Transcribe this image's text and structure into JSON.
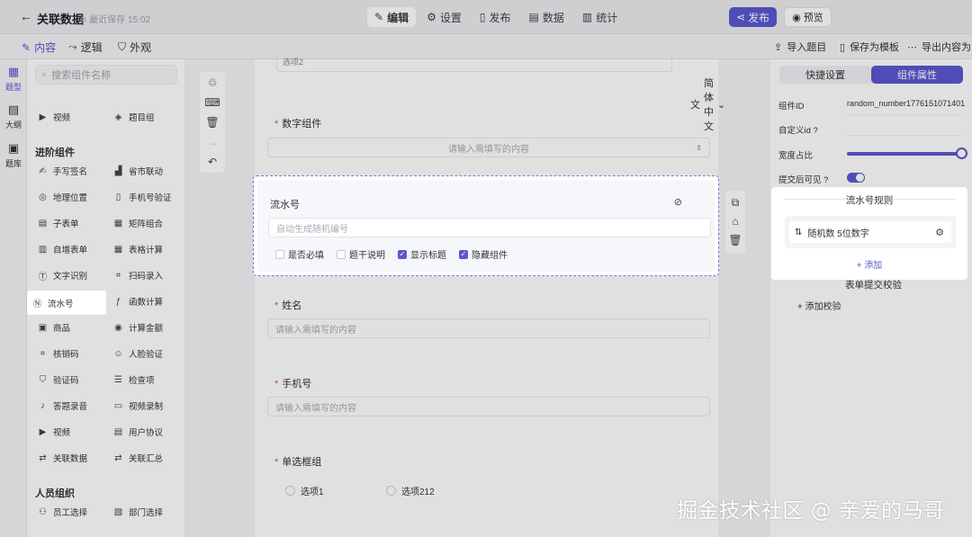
{
  "header": {
    "back_icon": "arrow-left-icon",
    "title": "关联数据",
    "save_status": "最近保存 15:02",
    "tabs": [
      {
        "label": "编辑",
        "icon": "edit-icon",
        "active": true
      },
      {
        "label": "设置",
        "icon": "gear-icon"
      },
      {
        "label": "发布",
        "icon": "file-icon"
      },
      {
        "label": "数据",
        "icon": "database-icon"
      },
      {
        "label": "统计",
        "icon": "chart-icon"
      }
    ],
    "publish_label": "发布",
    "preview_label": "预览"
  },
  "subbar": {
    "tabs": [
      {
        "label": "内容",
        "icon": "edit-icon",
        "active": true
      },
      {
        "label": "逻辑",
        "icon": "logic-icon"
      },
      {
        "label": "外观",
        "icon": "shirt-icon"
      }
    ],
    "actions": [
      {
        "label": "导入题目",
        "icon": "upload-icon"
      },
      {
        "label": "保存为模板",
        "icon": "template-icon"
      },
      {
        "label": "导出内容为",
        "icon": "more-icon"
      }
    ]
  },
  "rail": [
    {
      "label": "题型",
      "icon": "grid-icon",
      "active": true
    },
    {
      "label": "大纲",
      "icon": "outline-icon"
    },
    {
      "label": "题库",
      "icon": "library-icon"
    }
  ],
  "component_panel": {
    "search_placeholder": "搜索组件名称",
    "top_items": [
      {
        "label": "视频",
        "icon": "play-icon"
      },
      {
        "label": "题目组",
        "icon": "layers-icon"
      }
    ],
    "advanced_title": "进阶组件",
    "advanced": [
      {
        "label": "手写签名",
        "icon": "pen-icon"
      },
      {
        "label": "省市联动",
        "icon": "city-icon"
      },
      {
        "label": "地理位置",
        "icon": "location-icon"
      },
      {
        "label": "手机号验证",
        "icon": "phone-icon"
      },
      {
        "label": "子表单",
        "icon": "subform-icon"
      },
      {
        "label": "矩阵组合",
        "icon": "matrix-icon"
      },
      {
        "label": "自增表单",
        "icon": "table-add-icon"
      },
      {
        "label": "表格计算",
        "icon": "table-calc-icon"
      },
      {
        "label": "文字识别",
        "icon": "ocr-icon"
      },
      {
        "label": "扫码录入",
        "icon": "scan-icon"
      },
      {
        "label": "流水号",
        "icon": "serial-number-icon",
        "highlight": true
      },
      {
        "label": "函数计算",
        "icon": "function-icon"
      },
      {
        "label": "商品",
        "icon": "goods-icon"
      },
      {
        "label": "计算金额",
        "icon": "money-icon"
      },
      {
        "label": "核销码",
        "icon": "qr-icon"
      },
      {
        "label": "人脸验证",
        "icon": "face-icon"
      },
      {
        "label": "验证码",
        "icon": "shield-icon"
      },
      {
        "label": "检查项",
        "icon": "checklist-icon"
      },
      {
        "label": "答题录音",
        "icon": "mic-icon"
      },
      {
        "label": "视频录制",
        "icon": "video-record-icon"
      },
      {
        "label": "视频",
        "icon": "play-icon"
      },
      {
        "label": "用户协议",
        "icon": "agreement-icon"
      },
      {
        "label": "关联数据",
        "icon": "link-data-icon"
      },
      {
        "label": "关联汇总",
        "icon": "link-summary-icon"
      }
    ],
    "people_title": "人员组织",
    "people": [
      {
        "label": "员工选择",
        "icon": "user-icon"
      },
      {
        "label": "部门选择",
        "icon": "dept-icon"
      }
    ]
  },
  "canvas": {
    "top_stub_text": "选项2",
    "lang_label": "简体中文",
    "fields": [
      {
        "label": "数字组件",
        "required": true,
        "placeholder": "请输入需填写的内容"
      },
      {
        "label": "姓名",
        "required": true,
        "placeholder": "请输入需填写的内容"
      },
      {
        "label": "手机号",
        "required": true,
        "placeholder": "请输入需填写的内容"
      },
      {
        "label": "单选框组",
        "required": true
      }
    ],
    "radio_options": [
      "选项1",
      "选项212"
    ],
    "selected_card": {
      "title": "流水号",
      "placeholder": "自动生成随机编号",
      "options": [
        {
          "label": "是否必填",
          "checked": false
        },
        {
          "label": "题干说明",
          "checked": false
        },
        {
          "label": "显示标题",
          "checked": true
        },
        {
          "label": "隐藏组件",
          "checked": true
        }
      ]
    }
  },
  "right_panel": {
    "tabs": [
      {
        "label": "快捷设置"
      },
      {
        "label": "组件属性",
        "active": true
      }
    ],
    "component_id_label": "组件ID",
    "component_id_value": "random_number1776151071401",
    "custom_id_label": "自定义id",
    "width_label": "宽度占比",
    "width_value": 1.0,
    "visible_label": "提交后可见",
    "visible_on": true,
    "rule_title": "流水号规则",
    "rule_item": "随机数 5位数字",
    "rule_add": "添加",
    "form_check_title": "表单提交校验",
    "add_check": "添加校验"
  },
  "watermark": "掘金技术社区 @ 亲爱的马哥",
  "colors": {
    "accent": "#5b57d1",
    "required": "#e34d59"
  }
}
